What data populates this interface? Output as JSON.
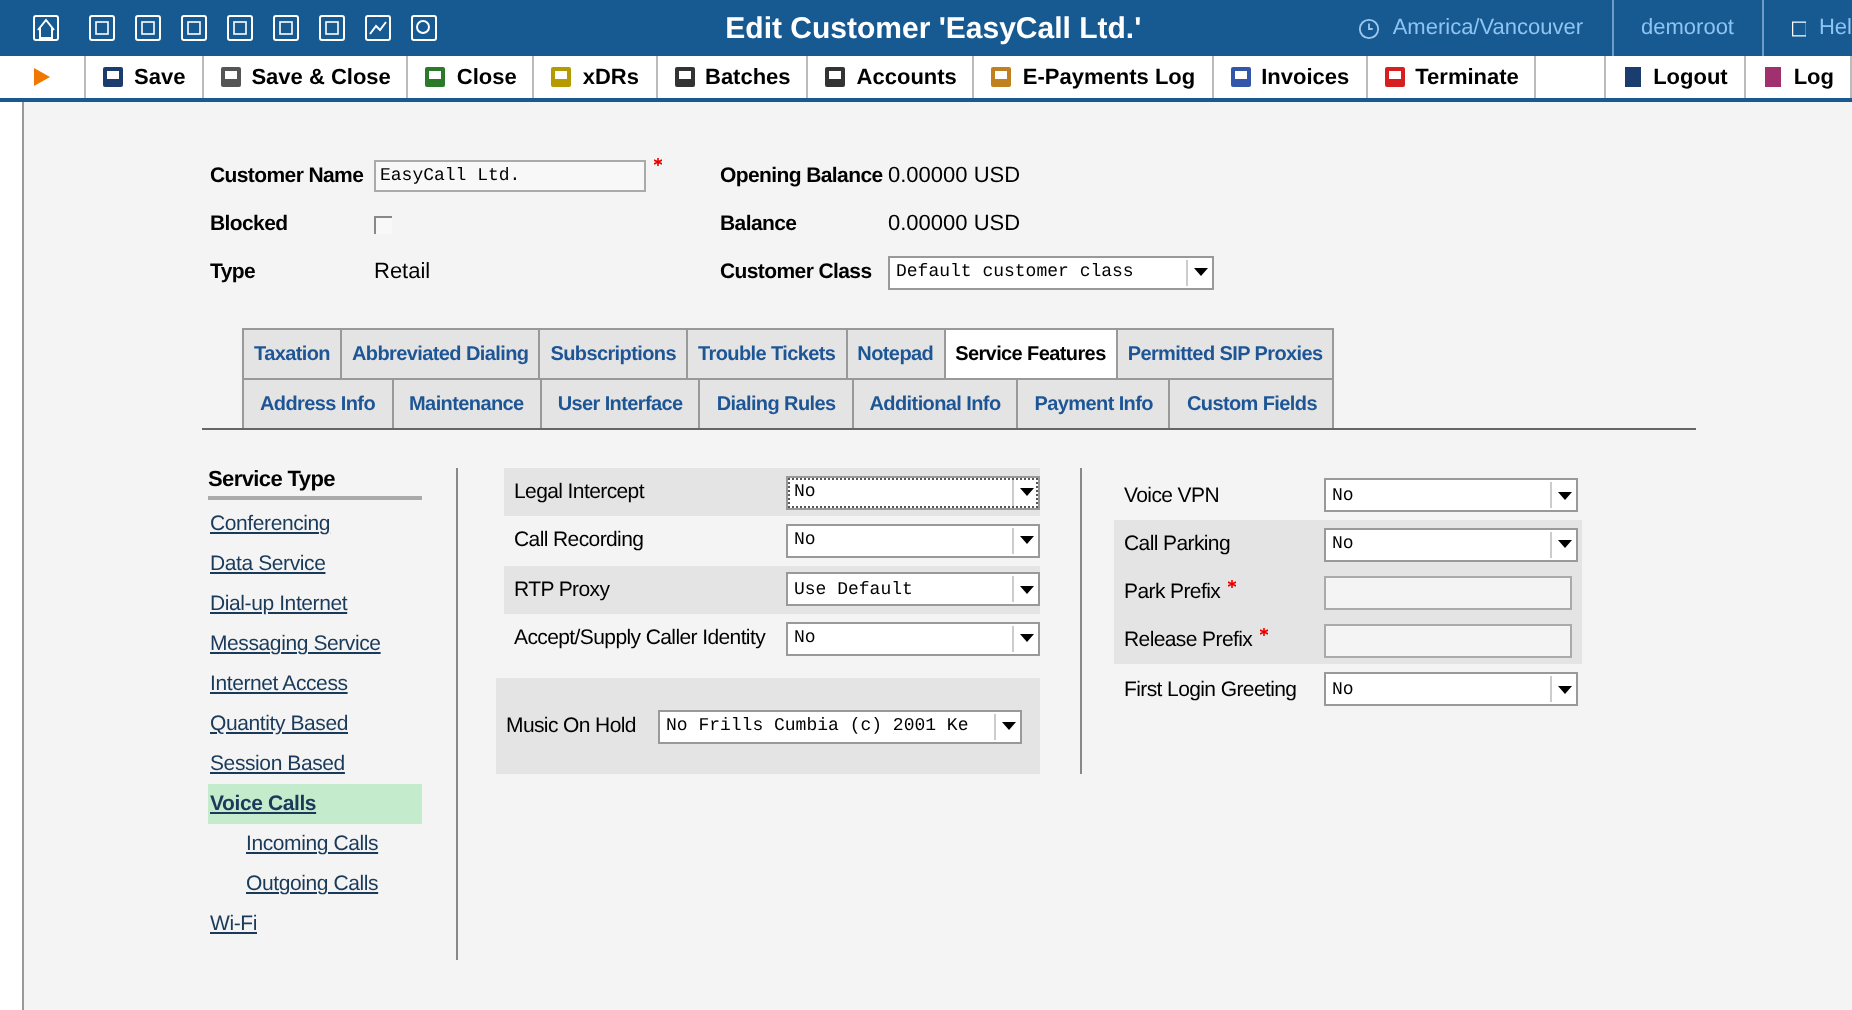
{
  "header": {
    "title": "Edit Customer 'EasyCall Ltd.'",
    "timezone": "America/Vancouver",
    "user": "demoroot",
    "help": "Hel"
  },
  "toolbar": [
    {
      "label": "Save"
    },
    {
      "label": "Save & Close"
    },
    {
      "label": "Close"
    },
    {
      "label": "xDRs"
    },
    {
      "label": "Batches"
    },
    {
      "label": "Accounts"
    },
    {
      "label": "E-Payments Log"
    },
    {
      "label": "Invoices"
    },
    {
      "label": "Terminate"
    }
  ],
  "toolbar_right": [
    {
      "label": "Logout"
    },
    {
      "label": "Log"
    }
  ],
  "customer": {
    "name": {
      "label": "Customer Name",
      "value": "EasyCall Ltd.",
      "required": true
    },
    "blocked": {
      "label": "Blocked",
      "checked": false
    },
    "type": {
      "label": "Type",
      "value": "Retail"
    },
    "opening_balance": {
      "label": "Opening Balance",
      "value": "0.00000 USD"
    },
    "balance": {
      "label": "Balance",
      "value": "0.00000 USD"
    },
    "customer_class": {
      "label": "Customer Class",
      "value": "Default customer class"
    }
  },
  "tabs": [
    [
      {
        "label": "Taxation",
        "selected": false
      },
      {
        "label": "Abbreviated Dialing",
        "selected": false
      },
      {
        "label": "Subscriptions",
        "selected": false
      },
      {
        "label": "Trouble Tickets",
        "selected": false
      },
      {
        "label": "Notepad",
        "selected": false
      },
      {
        "label": "Service Features",
        "selected": true
      },
      {
        "label": "Permitted SIP Proxies",
        "selected": false
      }
    ],
    [
      {
        "label": "Address Info",
        "selected": false
      },
      {
        "label": "Maintenance",
        "selected": false
      },
      {
        "label": "User Interface",
        "selected": false
      },
      {
        "label": "Dialing Rules",
        "selected": false
      },
      {
        "label": "Additional Info",
        "selected": false
      },
      {
        "label": "Payment Info",
        "selected": false
      },
      {
        "label": "Custom Fields",
        "selected": false
      }
    ]
  ],
  "sidebar": {
    "title": "Service Type",
    "items": [
      {
        "label": "Conferencing",
        "selected": false
      },
      {
        "label": "Data Service",
        "selected": false
      },
      {
        "label": "Dial-up Internet",
        "selected": false
      },
      {
        "label": "Messaging Service",
        "selected": false
      },
      {
        "label": "Internet Access",
        "selected": false
      },
      {
        "label": "Quantity Based",
        "selected": false
      },
      {
        "label": "Session Based",
        "selected": false
      },
      {
        "label": "Voice Calls",
        "selected": true,
        "children": [
          {
            "label": "Incoming Calls",
            "selected": false
          },
          {
            "label": "Outgoing Calls",
            "selected": false
          }
        ]
      },
      {
        "label": "Wi-Fi",
        "selected": false
      }
    ]
  },
  "features_left": [
    {
      "kind": "select",
      "label": "Legal Intercept",
      "value": "No"
    },
    {
      "kind": "select",
      "label": "Call Recording",
      "value": "No"
    },
    {
      "kind": "select",
      "label": "RTP Proxy",
      "value": "Use Default"
    },
    {
      "kind": "select",
      "label": "Accept/Supply Caller Identity",
      "value": "No"
    },
    {
      "kind": "group",
      "rows": [
        {
          "kind": "select",
          "label": "Music On Hold",
          "value": "No Frills Cumbia (c) 2001 Ke"
        }
      ]
    }
  ],
  "features_right": [
    {
      "kind": "select",
      "label": "Voice VPN",
      "value": "No"
    },
    {
      "kind": "group",
      "rows": [
        {
          "kind": "select",
          "label": "Call Parking",
          "value": "No"
        },
        {
          "kind": "text",
          "label": "Park Prefix",
          "required": true
        },
        {
          "kind": "text",
          "label": "Release Prefix",
          "required": true
        }
      ]
    },
    {
      "kind": "select",
      "label": "First Login Greeting",
      "value": "No"
    }
  ]
}
